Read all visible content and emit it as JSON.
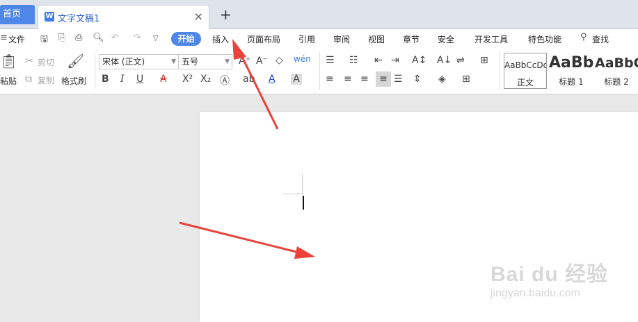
{
  "tabs": {
    "home_label": "首页",
    "doc_icon": "W",
    "doc_title": "文字文稿1",
    "close_symbol": "×",
    "add_symbol": "+"
  },
  "menu": {
    "file_label": "文件",
    "items": [
      "开始",
      "插入",
      "页面布局",
      "引用",
      "审阅",
      "视图",
      "章节",
      "安全",
      "开发工具",
      "特色功能"
    ],
    "search_label": "查找",
    "accent": "#4f87e8"
  },
  "ribbon": {
    "paste_label": "粘贴",
    "cut_label": "剪切",
    "copy_label": "复制",
    "format_painter_label": "格式刷",
    "font_name": "宋体 (正文)",
    "font_size": "五号",
    "styles": [
      {
        "preview": "AaBbCcDd",
        "label": "正文"
      },
      {
        "preview": "AaBb",
        "label": "标题 1"
      },
      {
        "preview": "AaBbC",
        "label": "标题 2"
      }
    ]
  },
  "watermark": {
    "line1": "Bai du 经验",
    "line2": "jingyan.baidu.com"
  },
  "arrows_color": "#e8423a"
}
